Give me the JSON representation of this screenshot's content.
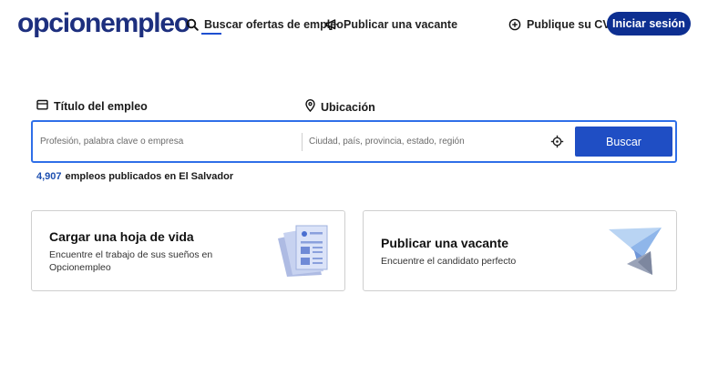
{
  "header": {
    "logo": "opcionempleo",
    "nav": {
      "search_jobs": "Buscar ofertas de empleo",
      "post_vacancy": "Publicar una vacante",
      "post_cv": "Publique su CV"
    },
    "login": "Iniciar sesión"
  },
  "search": {
    "job_label": "Título del empleo",
    "location_label": "Ubicación",
    "job_placeholder": "Profesión, palabra clave o empresa",
    "location_placeholder": "Ciudad, país, provincia, estado, región",
    "job_value": "",
    "location_value": "",
    "button": "Buscar",
    "count": "4,907",
    "count_text": "empleos publicados en El Salvador"
  },
  "cards": {
    "cv": {
      "title": "Cargar una hoja de vida",
      "description": "Encuentre el trabajo de sus sueños en Opcionempleo"
    },
    "vacancy": {
      "title": "Publicar una vacante",
      "description": "Encuentre el candidato perfecto"
    }
  },
  "colors": {
    "brand": "#1d2f7e",
    "primary_button": "#0d2f91",
    "search_button": "#1f4ec4",
    "focus_border": "#2f6fe8",
    "count_accent": "#1d4fb0"
  },
  "icons": [
    "search-icon",
    "megaphone-icon",
    "plus-circle-icon",
    "briefcase-icon",
    "location-pin-icon",
    "crosshair-locate-icon",
    "cv-document-illustration",
    "paper-plane-illustration"
  ]
}
